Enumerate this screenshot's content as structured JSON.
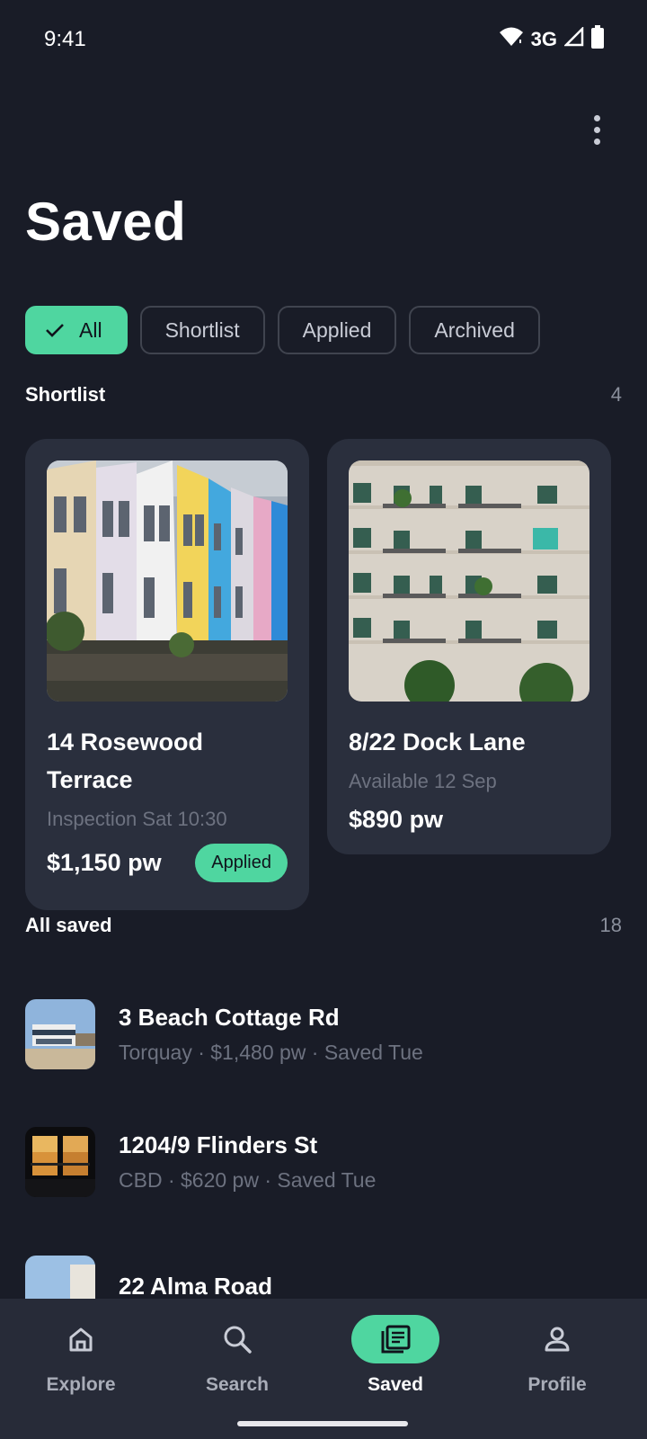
{
  "status_bar": {
    "time": "9:41",
    "network": "3G"
  },
  "page": {
    "title": "Saved"
  },
  "filters": [
    {
      "label": "All",
      "selected": true
    },
    {
      "label": "Shortlist",
      "selected": false
    },
    {
      "label": "Applied",
      "selected": false
    },
    {
      "label": "Archived",
      "selected": false
    }
  ],
  "shortlist": {
    "title": "Shortlist",
    "count": "4",
    "cards": [
      {
        "title": "14 Rosewood Terrace",
        "subtitle": "Inspection Sat 10:30",
        "price": "$1,150 pw",
        "badge": "Applied"
      },
      {
        "title": "8/22 Dock Lane",
        "subtitle": "Available 12 Sep",
        "price": "$890 pw"
      }
    ]
  },
  "all_saved": {
    "title": "All saved",
    "count": "18",
    "items": [
      {
        "title": "3 Beach Cottage Rd",
        "subtitle": "Torquay · $1,480 pw · Saved Tue"
      },
      {
        "title": "1204/9 Flinders St",
        "subtitle": "CBD · $620 pw · Saved Tue"
      },
      {
        "title": "22 Alma Road",
        "subtitle": ""
      }
    ]
  },
  "nav": [
    {
      "label": "Explore",
      "icon": "home-icon",
      "active": false
    },
    {
      "label": "Search",
      "icon": "search-icon",
      "active": false
    },
    {
      "label": "Saved",
      "icon": "saved-listings-icon",
      "active": true
    },
    {
      "label": "Profile",
      "icon": "person-icon",
      "active": false
    }
  ],
  "colors": {
    "background": "#191c27",
    "surface": "#2a2f3d",
    "accent": "#4fd6a0",
    "nav": "#272b38"
  }
}
